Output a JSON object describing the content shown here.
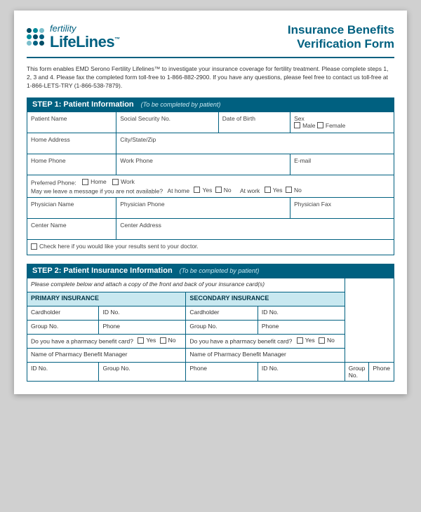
{
  "header": {
    "logo_fertility": "fertility",
    "logo_lifelines": "LifeLines",
    "title_line1": "Insurance Benefits",
    "title_line2": "Verification Form"
  },
  "intro": {
    "text": "This form enables EMD Serono Fertility Lifelines™ to investigate your insurance coverage for fertility treatment. Please complete steps 1, 2, 3 and 4. Please fax the completed form toll-free to 1-866-882-2900. If you have any questions, please feel free to contact us toll-free at 1-866-LETS-TRY (1-866-538-7879)."
  },
  "step1": {
    "title": "STEP 1: Patient Information",
    "subtitle": "(To be completed by patient)",
    "fields": {
      "patient_name": "Patient Name",
      "ssn": "Social Security No.",
      "dob": "Date of Birth",
      "sex": "Sex",
      "sex_male": "Male",
      "sex_female": "Female",
      "home_address": "Home Address",
      "city_state_zip": "City/State/Zip",
      "home_phone": "Home Phone",
      "work_phone": "Work Phone",
      "email": "E-mail",
      "preferred_phone": "Preferred Phone:",
      "pref_home": "Home",
      "pref_work": "Work",
      "voicemail_label": "May we leave a message if you are not available?",
      "at_home": "At home",
      "yes": "Yes",
      "no": "No",
      "at_work": "At work",
      "physician_name": "Physician Name",
      "physician_phone": "Physician Phone",
      "physician_fax": "Physician Fax",
      "center_name": "Center Name",
      "center_address": "Center Address",
      "results_check": "Check here if you would like your results sent to your doctor."
    }
  },
  "step2": {
    "title": "STEP 2: Patient Insurance Information",
    "subtitle": "(To be completed by patient)",
    "attach_note": "Please complete below and attach a copy of the front and back of your insurance card(s)",
    "primary_header": "PRIMARY INSURANCE",
    "secondary_header": "SECONDARY INSURANCE",
    "fields": {
      "cardholder": "Cardholder",
      "id_no": "ID No.",
      "group_no": "Group No.",
      "phone": "Phone",
      "pharmacy_question": "Do you have a pharmacy benefit card?",
      "yes": "Yes",
      "no": "No",
      "pharmacy_manager": "Name of Pharmacy Benefit Manager"
    }
  }
}
